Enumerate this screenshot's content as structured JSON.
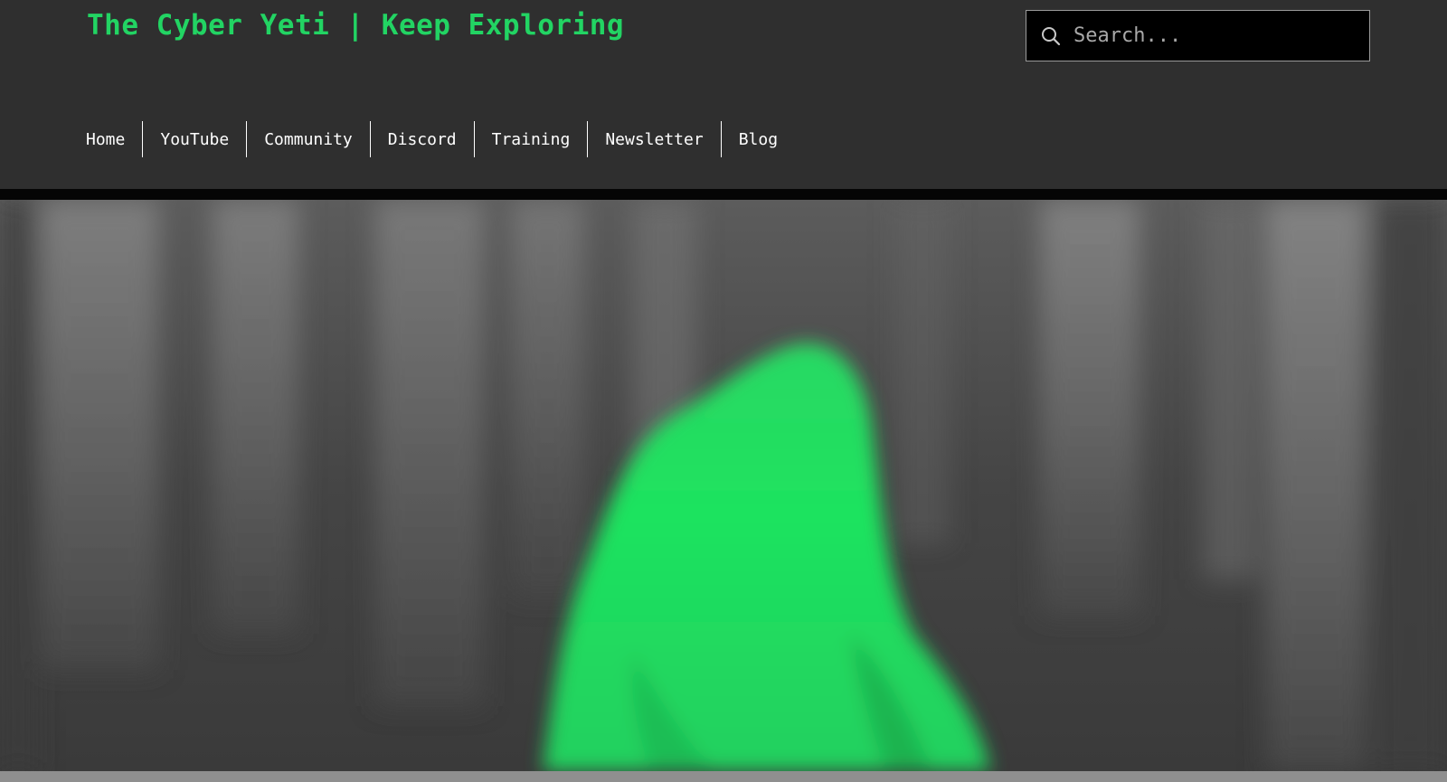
{
  "site": {
    "title": "The Cyber Yeti | Keep Exploring"
  },
  "search": {
    "placeholder": "Search...",
    "value": ""
  },
  "nav": {
    "items": [
      {
        "label": "Home"
      },
      {
        "label": "YouTube"
      },
      {
        "label": "Community"
      },
      {
        "label": "Discord"
      },
      {
        "label": "Training"
      },
      {
        "label": "Newsletter"
      },
      {
        "label": "Blog"
      }
    ]
  },
  "colors": {
    "accent": "#22d463",
    "header_bg": "#2f2f2f",
    "nav_text": "#ffffff",
    "search_bg": "#000000"
  },
  "icons": {
    "search": "search-icon"
  },
  "hero": {
    "image": "hero-image"
  }
}
